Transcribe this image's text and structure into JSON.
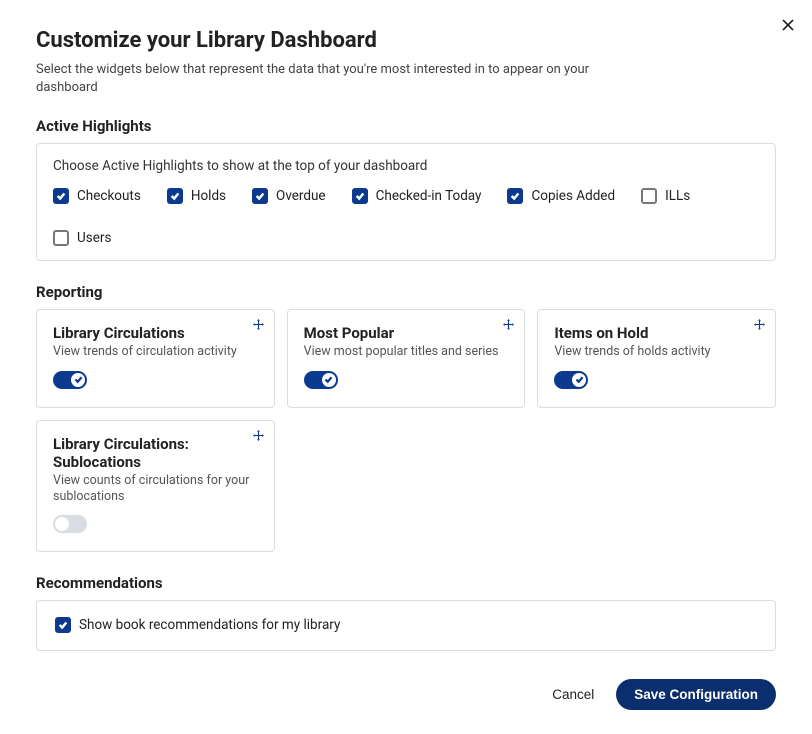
{
  "title": "Customize your Library Dashboard",
  "subtitle": "Select the widgets below that represent the data that you're most interested in to appear on your dashboard",
  "close_label": "Close",
  "highlights": {
    "section_label": "Active Highlights",
    "help": "Choose Active Highlights to show at the top of your dashboard",
    "items": [
      {
        "label": "Checkouts",
        "checked": true
      },
      {
        "label": "Holds",
        "checked": true
      },
      {
        "label": "Overdue",
        "checked": true
      },
      {
        "label": "Checked-in Today",
        "checked": true
      },
      {
        "label": "Copies Added",
        "checked": true
      },
      {
        "label": "ILLs",
        "checked": false
      },
      {
        "label": "Users",
        "checked": false
      }
    ]
  },
  "reporting": {
    "section_label": "Reporting",
    "cards": [
      {
        "title": "Library Circulations",
        "desc": "View trends of circulation activity",
        "enabled": true
      },
      {
        "title": "Most Popular",
        "desc": "View most popular titles and series",
        "enabled": true
      },
      {
        "title": "Items on Hold",
        "desc": "View trends of holds activity",
        "enabled": true
      },
      {
        "title": "Library Circulations: Sublocations",
        "desc": "View counts of circulations for your sublocations",
        "enabled": false
      }
    ]
  },
  "recommendations": {
    "section_label": "Recommendations",
    "checkbox_label": "Show book recommendations for my library",
    "checked": true
  },
  "footer": {
    "cancel": "Cancel",
    "save": "Save Configuration"
  }
}
